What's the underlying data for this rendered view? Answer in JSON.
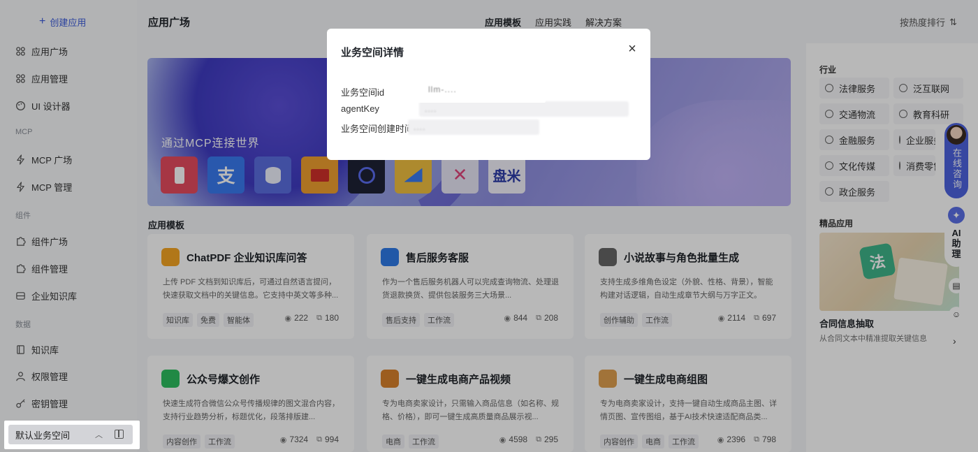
{
  "sidebar": {
    "create_label": "创建应用",
    "items": [
      {
        "label": "应用广场",
        "icon": "grid-icon"
      },
      {
        "label": "应用管理",
        "icon": "grid-icon"
      },
      {
        "label": "UI 设计器",
        "icon": "palette-icon"
      },
      {
        "label": "MCP 广场",
        "icon": "lightning-icon"
      },
      {
        "label": "MCP 管理",
        "icon": "lightning-icon"
      },
      {
        "label": "组件广场",
        "icon": "puzzle-icon"
      },
      {
        "label": "组件管理",
        "icon": "puzzle-icon"
      },
      {
        "label": "企业知识库",
        "icon": "database-icon"
      },
      {
        "label": "知识库",
        "icon": "book-icon"
      },
      {
        "label": "权限管理",
        "icon": "user-icon"
      },
      {
        "label": "密钥管理",
        "icon": "key-icon"
      }
    ],
    "sections": [
      "MCP",
      "组件",
      "数据"
    ],
    "workspace": "默认业务空间"
  },
  "header": {
    "title": "应用广场",
    "tabs": [
      "应用模板",
      "应用实践",
      "解决方案"
    ],
    "sort_label": "按热度排行"
  },
  "banner": {
    "title": "通过MCP连接世界",
    "logos": [
      {
        "text": "",
        "color": "#e64b5f"
      },
      {
        "text": "支",
        "color": "#3a7bf0"
      },
      {
        "text": "",
        "color": "#5a6ee0"
      },
      {
        "text": "",
        "color": "#f0a030"
      },
      {
        "text": "",
        "color": "#1e2235"
      },
      {
        "text": "",
        "color": "#f0c040"
      },
      {
        "text": "",
        "color": "#e8e6f6"
      },
      {
        "text": "盘米",
        "color": "#f3f2fb"
      }
    ]
  },
  "templates": {
    "title": "应用模板",
    "cards": [
      {
        "name": "ChatPDF 企业知识库问答",
        "desc": "上传 PDF 文档到知识库后，可通过自然语言提问，快速获取文档中的关键信息。它支持中英文等多种...",
        "tags": [
          "知识库",
          "免费",
          "智能体"
        ],
        "views": "222",
        "copies": "180",
        "color": "#f5a623"
      },
      {
        "name": "售后服务客服",
        "desc": "作为一个售后服务机器人可以完成查询物流、处理退货退款换货、提供包装服务三大场景...",
        "tags": [
          "售后支持",
          "工作流"
        ],
        "views": "844",
        "copies": "208",
        "color": "#2f7be8"
      },
      {
        "name": "小说故事与角色批量生成",
        "desc": "支持生成多维角色设定（外貌、性格、背景），智能构建对话逻辑，自动生成章节大纲与万字正文。",
        "tags": [
          "创作辅助",
          "工作流"
        ],
        "views": "2114",
        "copies": "697",
        "color": "#666666"
      },
      {
        "name": "公众号爆文创作",
        "desc": "快速生成符合微信公众号传播规律的图文混合内容，支持行业趋势分析，标题优化，段落排版建...",
        "tags": [
          "内容创作",
          "工作流"
        ],
        "views": "7324",
        "copies": "994",
        "color": "#2dbe60"
      },
      {
        "name": "一键生成电商产品视频",
        "desc": "专为电商卖家设计，只需输入商品信息（如名称、规格、价格），即可一键生成高质量商品展示视...",
        "tags": [
          "电商",
          "工作流"
        ],
        "views": "4598",
        "copies": "295",
        "color": "#d9822b"
      },
      {
        "name": "一键生成电商组图",
        "desc": "专为电商卖家设计，支持一键自动生成商品主图、详情页图、宣传图组，基于AI技术快速适配商品类...",
        "tags": [
          "内容创作",
          "电商",
          "工作流"
        ],
        "views": "2396",
        "copies": "798",
        "color": "#e0a050"
      }
    ]
  },
  "right_panel": {
    "industry_label": "行业",
    "industries": [
      "法律服务",
      "泛互联网",
      "交通物流",
      "教育科研",
      "金融服务",
      "企业服务",
      "文化传媒",
      "消费零售",
      "政企服务"
    ],
    "premium_label": "精品应用",
    "premium_name": "合同信息抽取",
    "premium_desc": "从合同文本中精准提取关键信息",
    "seal_text": "法"
  },
  "float": {
    "consult_label": "在线咨询",
    "ai_label": "AI助理"
  },
  "modal": {
    "title": "业务空间详情",
    "fields": [
      {
        "label": "业务空间id",
        "value": "llm-...."
      },
      {
        "label": "agentKey",
        "value": "...."
      },
      {
        "label": "业务空间创建时间",
        "value": "...."
      }
    ]
  }
}
